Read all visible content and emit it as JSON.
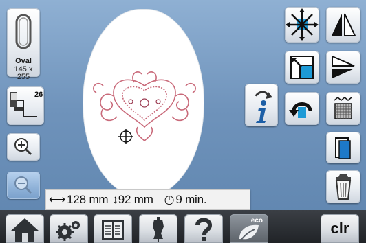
{
  "hoop": {
    "name": "Oval",
    "size": "145 x 255"
  },
  "presser_foot_number": "26",
  "status_bar": {
    "width": "128 mm",
    "height": "92 mm",
    "time": "9 min."
  },
  "bottom_nav": {
    "clear_label": "clr",
    "eco_label": "eco"
  },
  "icons": {
    "left": [
      "hoop-oval-icon",
      "presser-foot-icon",
      "zoom-in-icon",
      "zoom-out-icon"
    ],
    "center": [
      "rotate-info-icon",
      "info-icon"
    ],
    "right": [
      "move-center-icon",
      "mirror-horizontal-icon",
      "resize-icon",
      "mirror-vertical-icon",
      "rotate-icon",
      "pattern-fill-icon",
      "color-layer-icon",
      "delete-icon"
    ],
    "bottom": [
      "home-icon",
      "settings-icon",
      "book-icon",
      "dress-form-icon",
      "help-icon",
      "eco-icon",
      "clear-icon"
    ]
  },
  "colors": {
    "accent": "#1d5fa6",
    "design": "#c96a7a",
    "background": "#7c9fc7"
  }
}
